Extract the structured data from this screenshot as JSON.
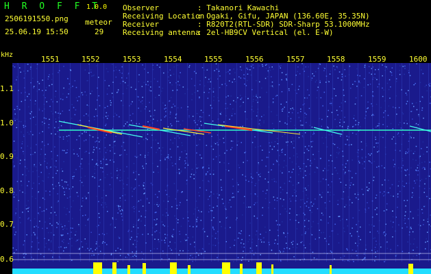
{
  "header": {
    "app_title": "H R O F F T",
    "version": "1.0.0",
    "filename": "2506191550.png",
    "datetime": "25.06.19 15:50",
    "meteor_label": "meteor",
    "meteor_count": "29",
    "info": [
      {
        "label": "Observer",
        "value": ": Takanori Kawachi"
      },
      {
        "label": "Receiving Location",
        "value": ": Ogaki, Gifu, JAPAN (136.60E, 35.35N)"
      },
      {
        "label": "Receiver",
        "value": ": R820T2(RTL-SDR) SDR-Sharp 53.1000MHz"
      },
      {
        "label": "Receiving antenna",
        "value": ": 2el-HB9CV Vertical (el. E-W)"
      }
    ]
  },
  "axis": {
    "unit": "kHz",
    "x_ticks": [
      "1551",
      "1552",
      "1553",
      "1554",
      "1555",
      "1556",
      "1557",
      "1558",
      "1559",
      "1600"
    ],
    "y_ticks": [
      "1.1",
      "1.0",
      "0.9",
      "0.8",
      "0.7",
      "0.6"
    ]
  },
  "colors": {
    "background": "#1a1a8c",
    "carrier": "#33ffcc",
    "text_yellow": "#ffff33",
    "bars": "#ffff00",
    "baseline": "#22ddff"
  }
}
